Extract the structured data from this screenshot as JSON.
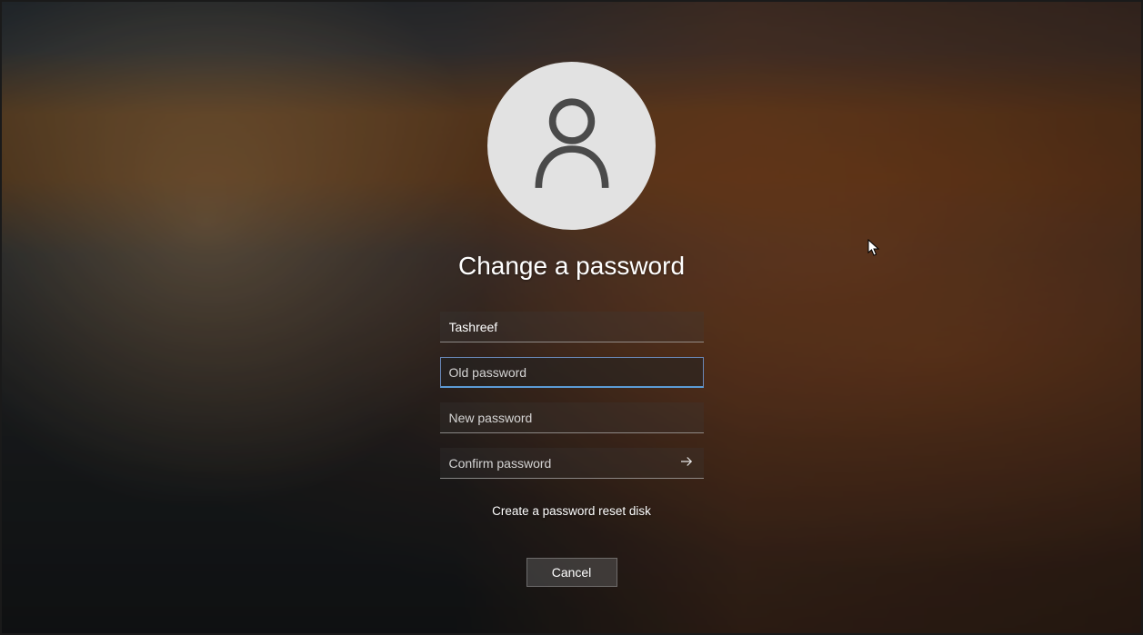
{
  "title": "Change a password",
  "username": "Tashreef",
  "fields": {
    "old_password": {
      "value": "",
      "placeholder": "Old password"
    },
    "new_password": {
      "value": "",
      "placeholder": "New password"
    },
    "confirm_password": {
      "value": "",
      "placeholder": "Confirm password"
    }
  },
  "link_label": "Create a password reset disk",
  "cancel_label": "Cancel"
}
